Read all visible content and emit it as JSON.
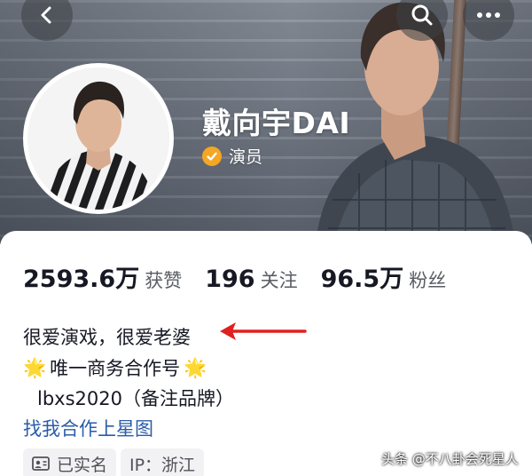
{
  "header": {
    "back_icon": "chevron-left-icon",
    "search_icon": "search-icon",
    "more_icon": "more-dots-icon"
  },
  "profile": {
    "name": "戴向宇DAI",
    "verified_title": "演员",
    "verified_icon": "check-badge-icon",
    "verified_color": "#f5a623"
  },
  "stats": [
    {
      "value": "2593.6万",
      "label": "获赞"
    },
    {
      "value": "196",
      "label": "关注"
    },
    {
      "value": "96.5万",
      "label": "粉丝"
    }
  ],
  "bio": {
    "line1": "很爱演戏，很爱老婆",
    "line2": "唯一商务合作号",
    "line2_emoji": "🌟",
    "line3": "lbxs2020（备注品牌）",
    "link": "找我合作上星图",
    "link_color": "#2b5ca8"
  },
  "tags": {
    "realname": "已实名",
    "ip": "IP：浙江"
  },
  "annotation": {
    "arrow_color": "#e02020"
  },
  "watermark": "头条 @不八卦会死星人"
}
